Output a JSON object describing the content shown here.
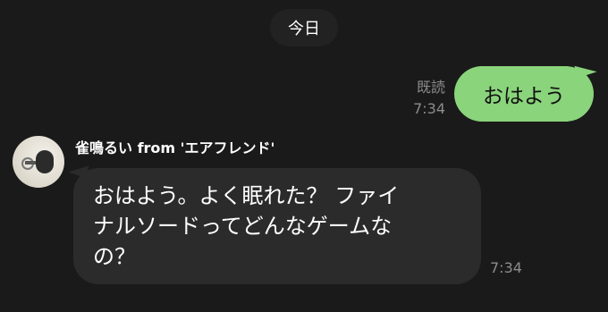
{
  "date_chip": "今日",
  "outgoing": {
    "read_label": "既読",
    "time": "7:34",
    "text": "おはよう"
  },
  "incoming": {
    "sender": "雀鳴るい from 'エアフレンド'",
    "text_lines": [
      "おはよう。よく眠れた？ ファイ",
      "ナルソードってどんなゲームな",
      "の？"
    ],
    "time": "7:34"
  },
  "colors": {
    "background": "#1a1a1a",
    "outgoing_bubble": "#8ad47b",
    "incoming_bubble": "#2b2b2b",
    "meta_text": "#8c8c8c"
  },
  "icons": {
    "avatar": "microphone-avatar"
  }
}
